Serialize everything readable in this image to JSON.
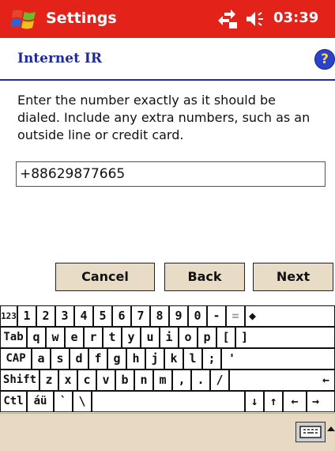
{
  "titlebar": {
    "app_title": "Settings",
    "clock": "03:39",
    "color": "#e3231a"
  },
  "page": {
    "title": "Internet IR",
    "help_glyph": "?",
    "instructions": "Enter the number exactly as it should be dialed.  Include any extra numbers, such as an outside line or credit card.",
    "number_value": "+88629877665"
  },
  "buttons": {
    "cancel": "Cancel",
    "back": "Back",
    "next": "Next"
  },
  "keyboard": {
    "rows": [
      [
        "123",
        "1",
        "2",
        "3",
        "4",
        "5",
        "6",
        "7",
        "8",
        "9",
        "0",
        "-",
        "=",
        "◆"
      ],
      [
        "Tab",
        "q",
        "w",
        "e",
        "r",
        "t",
        "y",
        "u",
        "i",
        "o",
        "p",
        "[",
        "]"
      ],
      [
        "CAP",
        "a",
        "s",
        "d",
        "f",
        "g",
        "h",
        "j",
        "k",
        "l",
        ";",
        "'"
      ],
      [
        "Shift",
        "z",
        "x",
        "c",
        "v",
        "b",
        "n",
        "m",
        ",",
        ".",
        "/",
        "←"
      ],
      [
        "Ctl",
        "áü",
        "`",
        "\\",
        "",
        "↓",
        "↑",
        "←",
        "→"
      ]
    ]
  },
  "icons": {
    "start": "windows-flag-icon",
    "connectivity": "connectivity-icon",
    "volume": "speaker-icon",
    "help": "help-icon",
    "sip": "keyboard-icon"
  }
}
